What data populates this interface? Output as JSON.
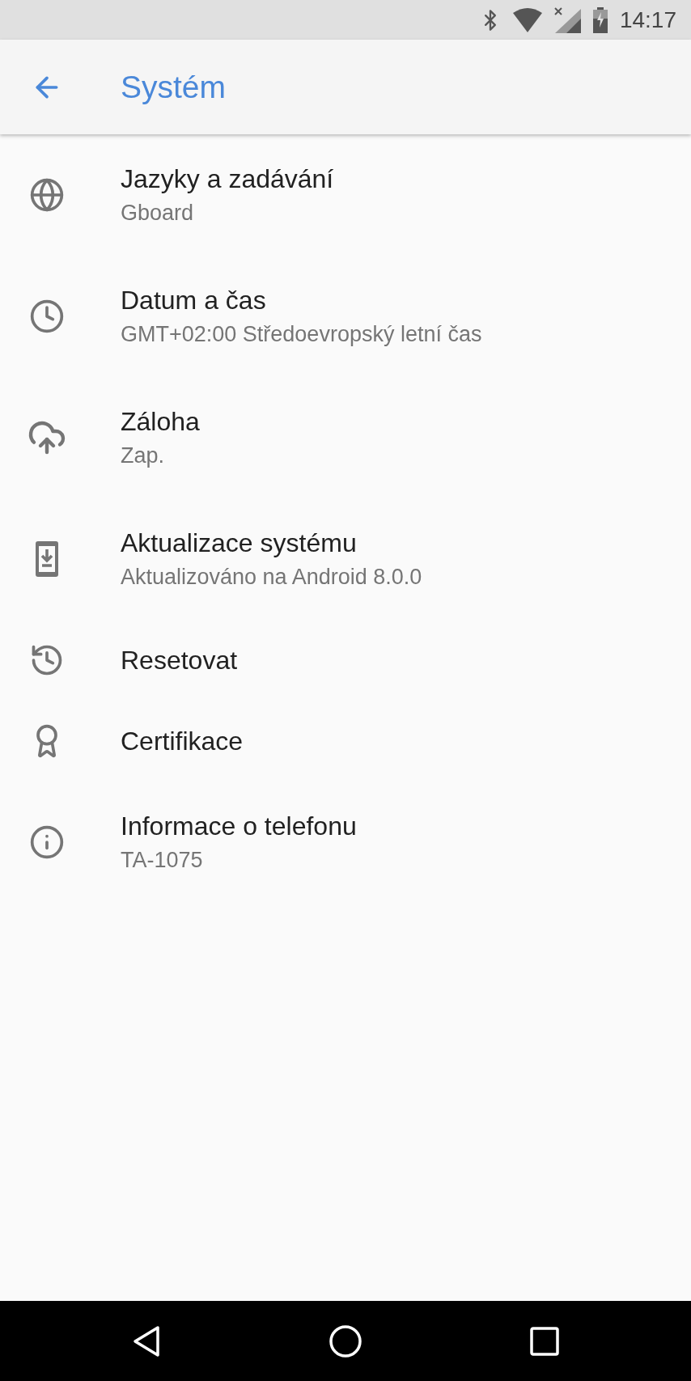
{
  "status_bar": {
    "time": "14:17"
  },
  "app_bar": {
    "title": "Systém"
  },
  "items": [
    {
      "title": "Jazyky a zadávání",
      "summary": "Gboard"
    },
    {
      "title": "Datum a čas",
      "summary": "GMT+02:00 Středoevropský letní čas"
    },
    {
      "title": "Záloha",
      "summary": "Zap."
    },
    {
      "title": "Aktualizace systému",
      "summary": "Aktualizováno na Android 8.0.0"
    },
    {
      "title": "Resetovat"
    },
    {
      "title": "Certifikace"
    },
    {
      "title": "Informace o telefonu",
      "summary": "TA-1075"
    }
  ]
}
